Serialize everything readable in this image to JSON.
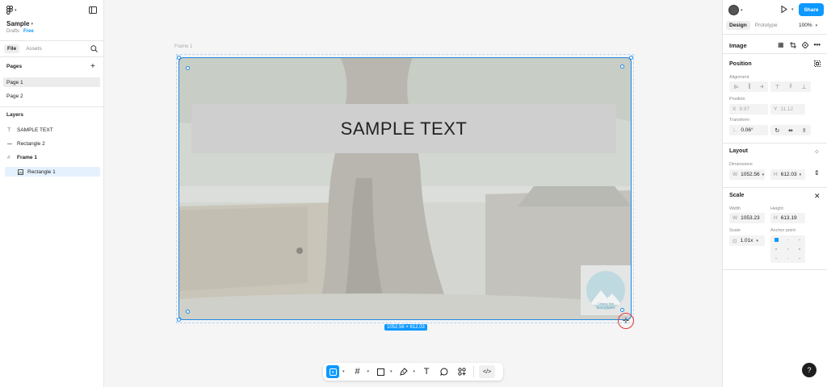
{
  "left_panel": {
    "file_name": "Sample",
    "drafts": "Drafts",
    "plan_badge": "Free",
    "tabs": [
      "File",
      "Assets"
    ],
    "pages_heading": "Pages",
    "pages": [
      "Page 1",
      "Page 2"
    ],
    "layers_heading": "Layers",
    "layers": [
      {
        "name": "SAMPLE TEXT",
        "icon": "text-icon"
      },
      {
        "name": "Rectangle 2",
        "icon": "line-icon"
      },
      {
        "name": "Frame 1",
        "icon": "frame-icon"
      },
      {
        "name": "Rectangle 1",
        "icon": "image-icon"
      }
    ]
  },
  "canvas": {
    "frame_label": "Frame 1",
    "sample_text": "SAMPLE TEXT",
    "size_label": "1052.56 × 612.03",
    "watermark_line1": "Chiang Mai",
    "watermark_line2": "BLD TOURS"
  },
  "toolbar": {
    "items": [
      "move-tool-icon",
      "frame-tool-icon",
      "rectangle-tool-icon",
      "pen-tool-icon",
      "text-tool-icon",
      "comment-tool-icon",
      "components-icon",
      "dev-mode-icon"
    ]
  },
  "right_panel": {
    "share_label": "Share",
    "tabs": [
      "Design",
      "Prototype"
    ],
    "zoom": "100%",
    "image_heading": "Image",
    "position_heading": "Position",
    "alignment_label": "Alignment",
    "position_label": "Position",
    "x_prefix": "X",
    "x_value": "9.97",
    "y_prefix": "Y",
    "y_value": "11.12",
    "transform_label": "Transform",
    "rotation": "0.06°",
    "layout_heading": "Layout",
    "dimensions_label": "Dimensions",
    "w_prefix": "W",
    "w_value": "1052.56",
    "h_prefix": "H",
    "h_value": "612.03",
    "scale_heading": "Scale",
    "width_label": "Width",
    "height_label": "Height",
    "scale_w": "1053.23",
    "scale_h": "613.19",
    "scale_label": "Scale",
    "anchor_label": "Anchor point",
    "scale_value": "1.01x",
    "help": "?"
  },
  "colors": {
    "accent": "#0d99ff",
    "selection": "#1e88e5",
    "cursor_ring": "#e53935"
  }
}
